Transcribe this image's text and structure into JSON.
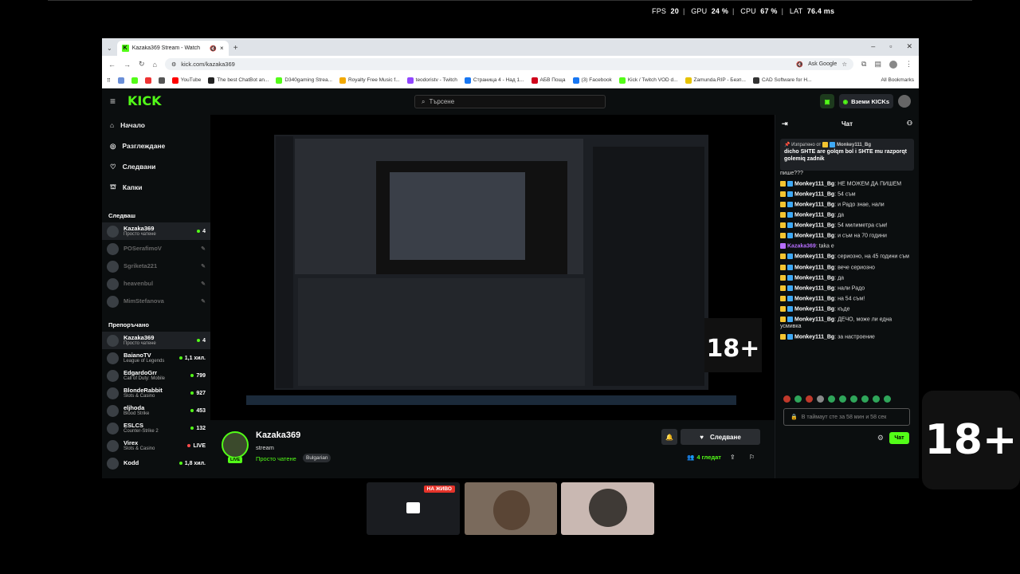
{
  "overlay": {
    "fps_label": "FPS",
    "fps": "20",
    "gpu_label": "GPU",
    "gpu": "24 %",
    "cpu_label": "CPU",
    "cpu": "67 %",
    "lat_label": "LAT",
    "lat": "76.4 ms"
  },
  "browser": {
    "tab_title": "Kazaka369 Stream - Watch",
    "new_tab": "+",
    "url": "kick.com/kazaka369",
    "ask_google": "Ask Google",
    "bookmarks": [
      {
        "label": "YouTube",
        "color": "#ff0000"
      },
      {
        "label": "The best ChatBot an...",
        "color": "#222"
      },
      {
        "label": "D340gaming Strea...",
        "color": "#53fc18"
      },
      {
        "label": "Royalty Free Music f...",
        "color": "#f2a900"
      },
      {
        "label": "teodoristv - Twitch",
        "color": "#9146ff"
      },
      {
        "label": "Страница 4 - Над 1...",
        "color": "#1877f2"
      },
      {
        "label": "АБВ Поща",
        "color": "#d0021b"
      },
      {
        "label": "(3) Facebook",
        "color": "#1877f2"
      },
      {
        "label": "Kick / Twitch VOD d...",
        "color": "#53fc18"
      },
      {
        "label": "Zamunda.RIP - Безп...",
        "color": "#e6c200"
      },
      {
        "label": "CAD Software for H...",
        "color": "#333"
      }
    ],
    "all_bookmarks": "All Bookmarks"
  },
  "kick": {
    "logo": "KICK",
    "search_placeholder": "Търсене",
    "get_kicks": "Вземи KICKs",
    "nav": [
      "Начало",
      "Разглеждане",
      "Следвани",
      "Капки"
    ],
    "following_title": "Следваш",
    "following": [
      {
        "name": "Kazaka369",
        "cat": "Просто чатене",
        "viewers": "4",
        "active": true
      },
      {
        "name": "POSerafimoV",
        "cat": "",
        "viewers": "",
        "active": false
      },
      {
        "name": "Sgriketa221",
        "cat": "",
        "viewers": "",
        "active": false
      },
      {
        "name": "heavenbul",
        "cat": "",
        "viewers": "",
        "active": false
      },
      {
        "name": "MimStefanova",
        "cat": "",
        "viewers": "",
        "active": false
      }
    ],
    "recommended_title": "Препоръчано",
    "recommended": [
      {
        "name": "Kazaka369",
        "cat": "Просто чатене",
        "viewers": "4",
        "active": true
      },
      {
        "name": "BaianoTV",
        "cat": "League of Legends",
        "viewers": "1,1 хил."
      },
      {
        "name": "EdgardoGrr",
        "cat": "Call of Duty: Mobile",
        "viewers": "799"
      },
      {
        "name": "BlondeRabbit",
        "cat": "Slots & Casino",
        "viewers": "927"
      },
      {
        "name": "eljhoda",
        "cat": "Blood Strike",
        "viewers": "453"
      },
      {
        "name": "ESLCS",
        "cat": "Counter-Strike 2",
        "viewers": "132"
      },
      {
        "name": "Virex",
        "cat": "Slots & Casino",
        "viewers": "LIVE"
      },
      {
        "name": "Kodd",
        "cat": "",
        "viewers": "1,8 хил."
      }
    ],
    "streamer": {
      "name": "Kazaka369",
      "title": "stream",
      "category": "Просто чатене",
      "tag": "Bulgarian",
      "live": "LIVE",
      "follow": "Следване",
      "viewers": "4 гледат"
    },
    "chat": {
      "title": "Чат",
      "pinned_by": "Изпратено от",
      "pinned_user": "Monkey111_Bg",
      "pinned_text": "dicho SHTE are golqm bol i SHTE mu razporqt golemiq zadnik",
      "partial": "пише???",
      "messages": [
        {
          "user": "Monkey111_Bg",
          "text": "НЕ МОЖЕМ ДА ПИШЕМ",
          "type": "mod"
        },
        {
          "user": "Monkey111_Bg",
          "text": "54 съм",
          "type": "mod"
        },
        {
          "user": "Monkey111_Bg",
          "text": "и Радо знае, нали",
          "type": "mod"
        },
        {
          "user": "Monkey111_Bg",
          "text": "да",
          "type": "mod"
        },
        {
          "user": "Monkey111_Bg",
          "text": "54 милиметра съм!",
          "type": "mod"
        },
        {
          "user": "Monkey111_Bg",
          "text": "и съм на 70 години",
          "type": "mod"
        },
        {
          "user": "Kazaka369",
          "text": "taka e",
          "type": "host"
        },
        {
          "user": "Monkey111_Bg",
          "text": "сериозно, на 45 години съм",
          "type": "mod"
        },
        {
          "user": "Monkey111_Bg",
          "text": "вече сериозно",
          "type": "mod"
        },
        {
          "user": "Monkey111_Bg",
          "text": "да",
          "type": "mod"
        },
        {
          "user": "Monkey111_Bg",
          "text": "нали Радо",
          "type": "mod"
        },
        {
          "user": "Monkey111_Bg",
          "text": "на 54 съм!",
          "type": "mod"
        },
        {
          "user": "Monkey111_Bg",
          "text": "къде",
          "type": "mod"
        },
        {
          "user": "Monkey111_Bg",
          "text": "ДЕЧО, може ли една усмивка",
          "type": "mod"
        },
        {
          "user": "Monkey111_Bg",
          "text": "за настроение",
          "type": "mod"
        }
      ],
      "input_placeholder": "В таймаут сте за 58 мин и 58 сек",
      "send": "Чат"
    }
  },
  "age_badge": "18+",
  "thumbs": {
    "live_label": "НА ЖИВО"
  }
}
